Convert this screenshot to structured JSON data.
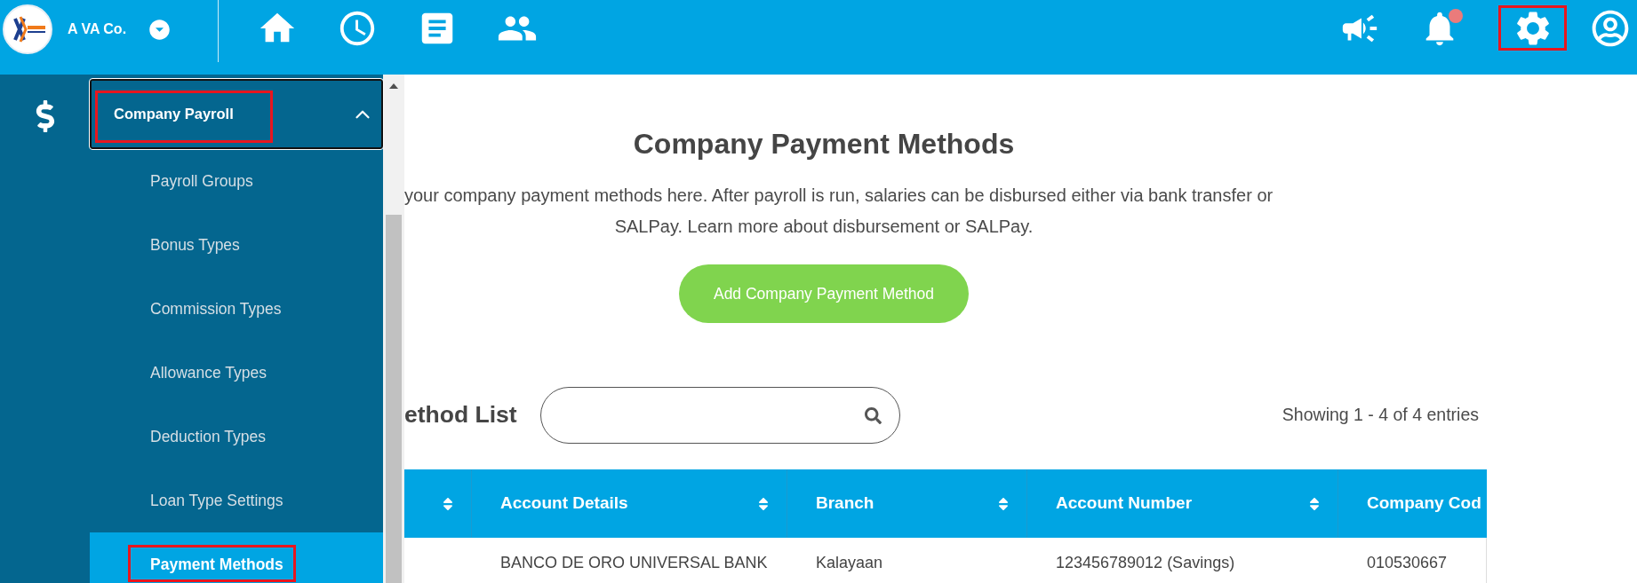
{
  "header": {
    "company": "A VA Co.",
    "notifications": {
      "unread": true
    },
    "settings": {
      "highlighted": true
    }
  },
  "menu": {
    "title": "Company Payroll",
    "expanded": true,
    "highlighted": true,
    "items": [
      {
        "label": "Payroll Groups",
        "selected": false,
        "highlighted": false
      },
      {
        "label": "Bonus Types",
        "selected": false,
        "highlighted": false
      },
      {
        "label": "Commission Types",
        "selected": false,
        "highlighted": false
      },
      {
        "label": "Allowance Types",
        "selected": false,
        "highlighted": false
      },
      {
        "label": "Deduction Types",
        "selected": false,
        "highlighted": false
      },
      {
        "label": "Loan Type Settings",
        "selected": false,
        "highlighted": false
      },
      {
        "label": "Payment Methods",
        "selected": true,
        "highlighted": true
      }
    ]
  },
  "page": {
    "title": "Company Payment Methods",
    "description": [
      "your company payment methods here. After payroll is run, salaries can be disbursed either via bank transfer or",
      "SALPay. Learn more about disbursement or SALPay."
    ],
    "add_button": "Add Company Payment Method"
  },
  "list": {
    "title": "ethod List",
    "summary": "Showing 1 - 4 of 4 entries",
    "columns": [
      {
        "sortable": true
      },
      {
        "label": "Account Details",
        "sortable": true
      },
      {
        "label": "Branch",
        "sortable": true
      },
      {
        "label": "Account Number",
        "sortable": true
      },
      {
        "label": "Company Cod",
        "sortable": false
      }
    ],
    "rows": [
      {
        "cells": [
          "",
          "BANCO DE ORO UNIVERSAL BANK",
          "Kalayaan",
          "123456789012 (Savings)",
          "010530667"
        ]
      }
    ]
  }
}
